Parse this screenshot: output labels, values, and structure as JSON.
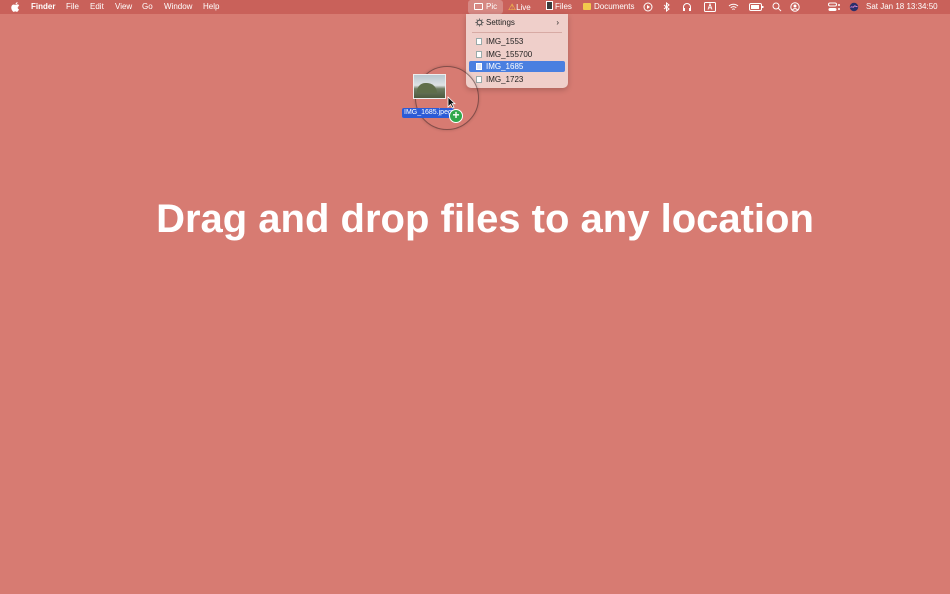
{
  "menubar": {
    "app_name": "Finder",
    "menus": [
      "File",
      "Edit",
      "View",
      "Go",
      "Window",
      "Help"
    ]
  },
  "status_bar": {
    "pic_label": "Pic",
    "live_label": "Live",
    "files_label": "Files",
    "documents_label": "Documents",
    "clock": "Sat Jan 18  13:34:50",
    "icons": [
      "play-circle-icon",
      "bluetooth-icon",
      "headphones-icon",
      "keyboard-a-icon",
      "wifi-icon",
      "battery-icon",
      "search-icon",
      "user-circle-icon",
      "control-center-icon",
      "siri-icon"
    ]
  },
  "dropdown": {
    "settings_label": "Settings",
    "files": [
      "IMG_1553",
      "IMG_155700",
      "IMG_1685",
      "IMG_1723"
    ],
    "selected": "IMG_1685"
  },
  "drag": {
    "filename": "IMG_1685.jpeg",
    "badge": "+"
  },
  "headline": "Drag and drop files to any location",
  "colors": {
    "background": "#d77b72",
    "menubar": "#c9615a",
    "selection": "#4a7fe0",
    "badge": "#2fa84b"
  }
}
